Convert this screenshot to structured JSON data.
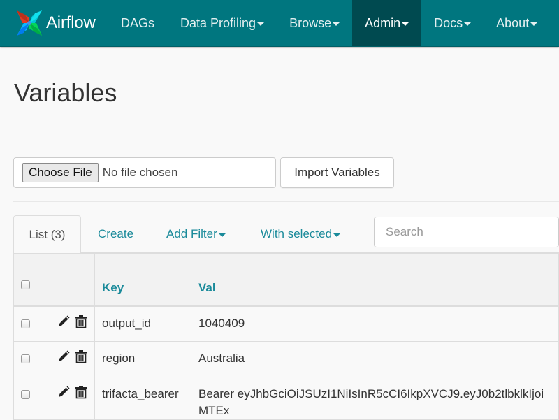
{
  "navbar": {
    "brand": "Airflow",
    "items": [
      {
        "label": "DAGs",
        "dropdown": false,
        "active": false
      },
      {
        "label": "Data Profiling",
        "dropdown": true,
        "active": false
      },
      {
        "label": "Browse",
        "dropdown": true,
        "active": false
      },
      {
        "label": "Admin",
        "dropdown": true,
        "active": true
      },
      {
        "label": "Docs",
        "dropdown": true,
        "active": false
      },
      {
        "label": "About",
        "dropdown": true,
        "active": false
      }
    ],
    "colors": {
      "background": "#00767f",
      "active": "#004a50"
    }
  },
  "page": {
    "title": "Variables"
  },
  "import": {
    "choose_file_label": "Choose File",
    "file_status": "No file chosen",
    "import_button": "Import Variables"
  },
  "tabs": {
    "list": "List (3)",
    "create": "Create",
    "add_filter": "Add Filter",
    "with_selected": "With selected"
  },
  "search": {
    "placeholder": "Search",
    "value": ""
  },
  "table": {
    "columns": [
      "",
      "",
      "Key",
      "Val"
    ],
    "rows": [
      {
        "key": "output_id",
        "val": "1040409"
      },
      {
        "key": "region",
        "val": "Australia"
      },
      {
        "key": "trifacta_bearer",
        "val": "Bearer eyJhbGciOiJSUzI1NiIsInR5cCI6IkpXVCJ9.eyJ0b2tlbklkIjoiMTEx"
      }
    ]
  },
  "icons": {
    "edit": "pencil-icon",
    "delete": "trash-icon",
    "logo": "airflow-pinwheel-logo"
  }
}
